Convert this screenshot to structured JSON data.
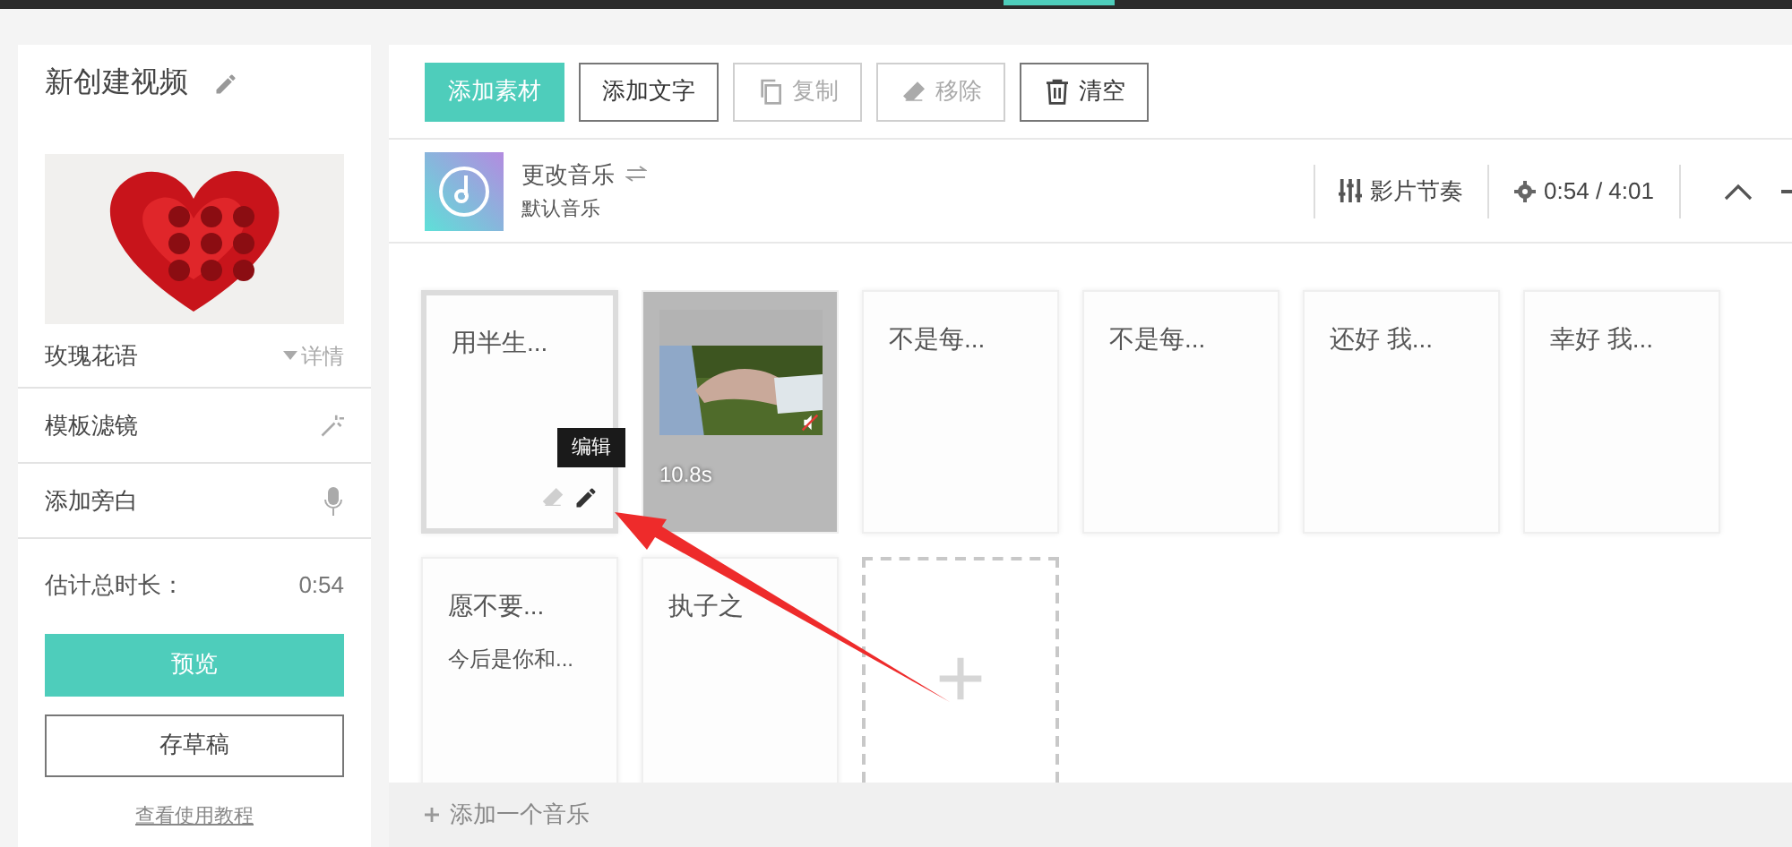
{
  "project": {
    "title": "新创建视频"
  },
  "template": {
    "name": "玫瑰花语",
    "details_label": "详情"
  },
  "sidebar_items": [
    {
      "label": "模板滤镜",
      "kind": "filter"
    },
    {
      "label": "添加旁白",
      "kind": "voice"
    }
  ],
  "duration": {
    "label": "估计总时长：",
    "value": "0:54"
  },
  "actions": {
    "preview": "预览",
    "save_draft": "存草稿",
    "tutorial": "查看使用教程"
  },
  "toolbar": [
    {
      "label": "添加素材",
      "kind": "primary",
      "disabled": false
    },
    {
      "label": "添加文字",
      "kind": "plain",
      "disabled": false
    },
    {
      "label": "复制",
      "kind": "copy",
      "disabled": true
    },
    {
      "label": "移除",
      "kind": "erase",
      "disabled": true
    },
    {
      "label": "清空",
      "kind": "trash",
      "disabled": false
    }
  ],
  "music": {
    "title": "更改音乐",
    "subtitle": "默认音乐",
    "rhythm_label": "影片节奏",
    "time": "0:54 / 4:01"
  },
  "cards": [
    {
      "kind": "text",
      "title": "用半生...",
      "selected": true,
      "tooltip": "编辑"
    },
    {
      "kind": "video",
      "duration": "10.8s",
      "muted": true,
      "selected": false
    },
    {
      "kind": "text",
      "title": "不是每...",
      "selected": false
    },
    {
      "kind": "text",
      "title": "不是每...",
      "selected": false
    },
    {
      "kind": "text",
      "title": "还好 我...",
      "selected": false
    },
    {
      "kind": "text",
      "title": "幸好 我...",
      "selected": false
    },
    {
      "kind": "text",
      "title": "愿不要...",
      "subtitle": "今后是你和...",
      "selected": false
    },
    {
      "kind": "text",
      "title": "执子之",
      "selected": false
    },
    {
      "kind": "add"
    }
  ],
  "add_music": "添加一个音乐"
}
